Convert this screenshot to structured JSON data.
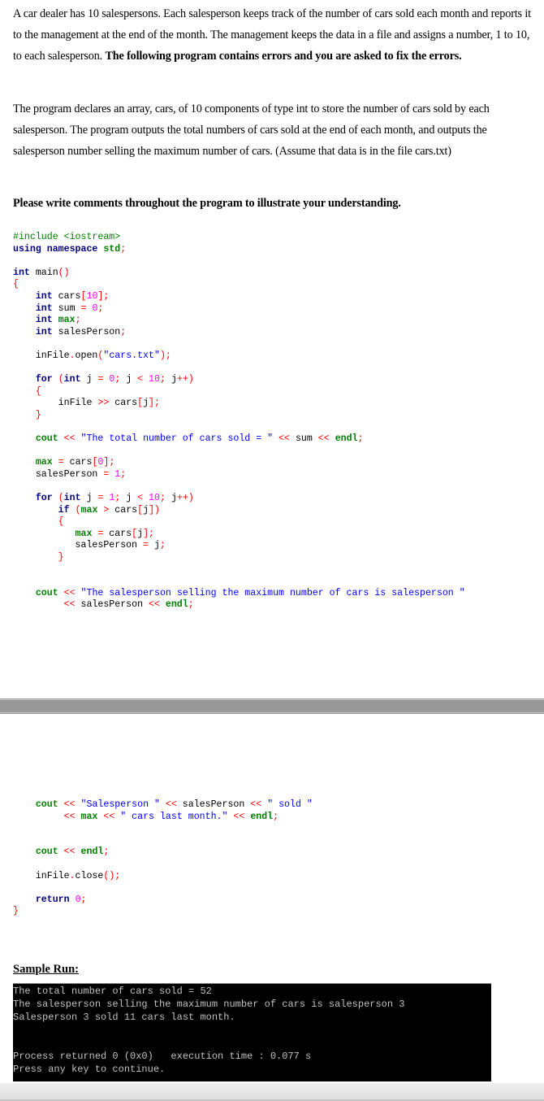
{
  "problem": {
    "para1_plain": "A car dealer has 10 salespersons. Each salesperson keeps track of the number of cars sold each month and reports it to the management at the end of the month. The management keeps the data in a file and assigns a number, 1 to 10, to each salesperson. ",
    "para1_bold": "The following program contains errors and you are asked to fix the errors.",
    "para2": "The program declares an array, cars, of 10 components of type int to store the number of cars sold by each salesperson. The program outputs the total numbers of cars sold at the end of each month, and outputs the salesperson number selling the maximum number of cars. (Assume that data is in the file cars.txt)",
    "instruction": "Please write comments throughout the program to illustrate your understanding."
  },
  "code_top": [
    "#include <iostream>",
    "using namespace std;",
    "",
    "int main()",
    "{",
    "    int cars[10];",
    "    int sum = 0;",
    "    int max;",
    "    int salesPerson;",
    "",
    "    inFile.open(\"cars.txt\");",
    "",
    "    for (int j = 0; j < 10; j++)",
    "    {",
    "        inFile >> cars[j];",
    "    }",
    "",
    "    cout << \"The total number of cars sold = \" << sum << endl;",
    "",
    "    max = cars[0];",
    "    salesPerson = 1;",
    "",
    "    for (int j = 1; j < 10; j++)",
    "        if (max > cars[j])",
    "        {",
    "           max = cars[j];",
    "           salesPerson = j;",
    "        }",
    "",
    "",
    "    cout << \"The salesperson selling the maximum number of cars is salesperson \"",
    "         << salesPerson << endl;"
  ],
  "code_bottom": [
    "    cout << \"Salesperson \" << salesPerson << \" sold \"",
    "         << max << \" cars last month.\" << endl;",
    "",
    "",
    "    cout << endl;",
    "",
    "    inFile.close();",
    "",
    "    return 0;",
    "}"
  ],
  "sample_run": {
    "title": "Sample Run:",
    "lines": [
      "The total number of cars sold = 52",
      "The salesperson selling the maximum number of cars is salesperson 3",
      "Salesperson 3 sold 11 cars last month.",
      "",
      "",
      "Process returned 0 (0x0)   execution time : 0.077 s",
      "Press any key to continue."
    ]
  },
  "colors": {
    "keyword": "#000080",
    "identifier_special": "#008000",
    "string": "#0000ff",
    "number": "#ff00ff",
    "operator": "#ff0000",
    "console_bg": "#000000",
    "console_text": "#c0c0c0",
    "divider": "#999999"
  }
}
